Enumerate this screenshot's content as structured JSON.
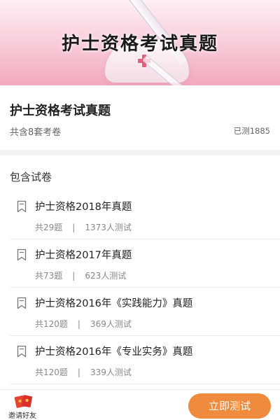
{
  "banner": {
    "title": "护士资格考试真题"
  },
  "info": {
    "title": "护士资格考试真题",
    "subtitle": "共含8套考卷",
    "tested": "已测1885"
  },
  "papers": {
    "heading": "包含试卷",
    "items": [
      {
        "title": "护士资格2018年真题",
        "questions": "共29题",
        "testers": "1373人测试"
      },
      {
        "title": "护士资格2017年真题",
        "questions": "共73题",
        "testers": "623人测试"
      },
      {
        "title": "护士资格2016年《实践能力》真题",
        "questions": "共120题",
        "testers": "369人测试"
      },
      {
        "title": "护士资格2016年《专业实务》真题",
        "questions": "共120题",
        "testers": "339人测试"
      }
    ],
    "separator": "|"
  },
  "bottom": {
    "invite_label": "邀请好友",
    "start_label": "立即测试"
  },
  "colors": {
    "accent": "#f08a3c",
    "banner_pink": "#f2a9c0",
    "cross": "#e0607e"
  },
  "icons": {
    "paper": "bookmark-page-icon",
    "invite": "red-envelope-icon"
  }
}
